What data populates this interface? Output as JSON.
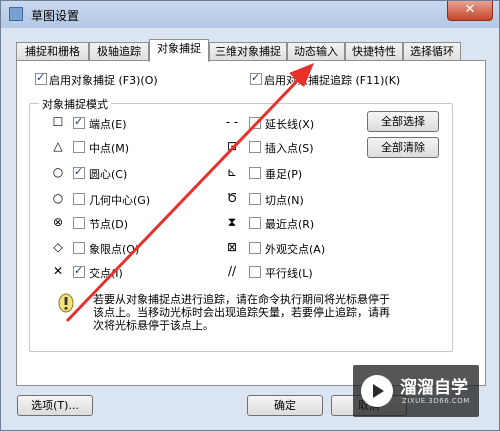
{
  "window": {
    "title": "草图设置",
    "close_label": "✕"
  },
  "tabs": [
    {
      "label": "捕捉和栅格",
      "active": false
    },
    {
      "label": "极轴追踪",
      "active": false
    },
    {
      "label": "对象捕捉",
      "active": true
    },
    {
      "label": "三维对象捕捉",
      "active": false
    },
    {
      "label": "动态输入",
      "active": false
    },
    {
      "label": "快捷特性",
      "active": false
    },
    {
      "label": "选择循环",
      "active": false
    }
  ],
  "top_options": {
    "enable_snap": {
      "label": "启用对象捕捉 (F3)(O)",
      "checked": true
    },
    "enable_tracking": {
      "label": "启用对象捕捉追踪 (F11)(K)",
      "checked": true
    }
  },
  "group": {
    "title": "对象捕捉模式",
    "left_modes": [
      {
        "symbol": "☐",
        "label": "端点(E)",
        "checked": true,
        "icon": "square-icon"
      },
      {
        "symbol": "△",
        "label": "中点(M)",
        "checked": false,
        "icon": "triangle-icon"
      },
      {
        "symbol": "○",
        "label": "圆心(C)",
        "checked": true,
        "icon": "circle-icon"
      },
      {
        "symbol": "○",
        "label": "几何中心(G)",
        "checked": false,
        "icon": "circle-icon"
      },
      {
        "symbol": "⊗",
        "label": "节点(D)",
        "checked": false,
        "icon": "node-icon"
      },
      {
        "symbol": "◇",
        "label": "象限点(Q)",
        "checked": false,
        "icon": "diamond-icon"
      },
      {
        "symbol": "✕",
        "label": "交点(I)",
        "checked": true,
        "icon": "cross-icon"
      }
    ],
    "right_modes": [
      {
        "symbol": "- -",
        "label": "延长线(X)",
        "checked": false,
        "icon": "extension-icon"
      },
      {
        "symbol": "⊡",
        "label": "插入点(S)",
        "checked": false,
        "icon": "insertion-icon"
      },
      {
        "symbol": "⊾",
        "label": "垂足(P)",
        "checked": false,
        "icon": "perpendicular-icon"
      },
      {
        "symbol": "Ծ",
        "label": "切点(N)",
        "checked": false,
        "icon": "tangent-icon"
      },
      {
        "symbol": "⧗",
        "label": "最近点(R)",
        "checked": false,
        "icon": "nearest-icon"
      },
      {
        "symbol": "⊠",
        "label": "外观交点(A)",
        "checked": false,
        "icon": "apparent-intersection-icon"
      },
      {
        "symbol": "//",
        "label": "平行线(L)",
        "checked": false,
        "icon": "parallel-icon"
      }
    ],
    "select_all": "全部选择",
    "clear_all": "全部清除"
  },
  "hint": {
    "line1": "若要从对象捕捉点进行追踪，请在命令执行期间将光标悬停于",
    "line2": "该点上。当移动光标时会出现追踪矢量，若要停止追踪，请再",
    "line3": "次将光标悬停于该点上。"
  },
  "footer": {
    "options": "选项(T)...",
    "ok": "确定",
    "cancel": "取消"
  },
  "watermark": {
    "name": "溜溜自学",
    "sub": "ZIXUE.3D66.COM"
  },
  "colors": {
    "arrow": "#e8302b",
    "accent": "#1c3e7a"
  }
}
